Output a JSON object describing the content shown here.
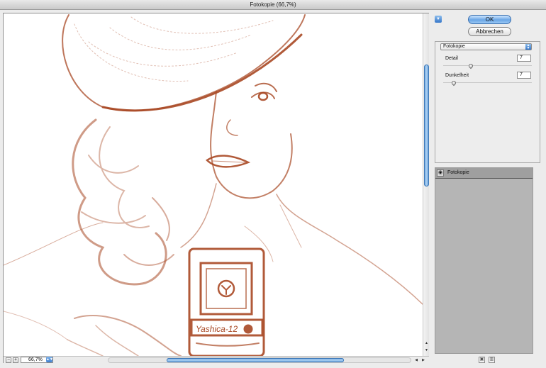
{
  "window": {
    "title": "Fotokopie (66,7%)"
  },
  "preview": {
    "zoom_value": "66,7%",
    "zoom_out": "−",
    "zoom_in": "+",
    "zoom_arrow": "▲▼",
    "camera_brand": "Yashica-12"
  },
  "buttons": {
    "ok": "OK",
    "cancel": "Abbrechen",
    "collapse": "▼"
  },
  "filter": {
    "selected": "Fotokopie",
    "params": [
      {
        "label": "Detail",
        "value": "7",
        "level": 0.3
      },
      {
        "label": "Dunkelheit",
        "value": "7",
        "level": 0.1
      }
    ]
  },
  "layers": [
    {
      "name": "Fotokopie",
      "eye": "◉"
    }
  ],
  "layer_buttons": {
    "new": "▣",
    "delete": "▥"
  },
  "colors": {
    "sketch": "#a84824",
    "accent": "#5b95d3"
  },
  "icons": [
    "collapse-icon",
    "eye-icon",
    "new-layer-icon",
    "trash-icon",
    "zoom-in-icon",
    "zoom-out-icon"
  ]
}
